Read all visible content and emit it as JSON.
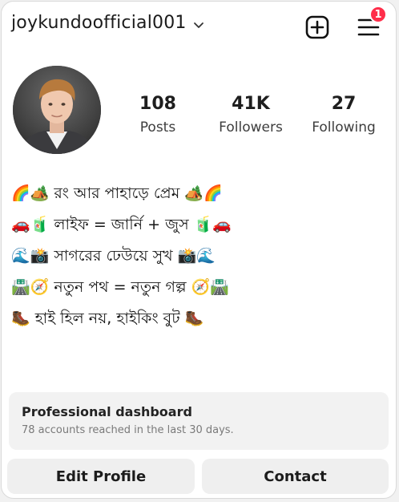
{
  "header": {
    "username": "joykundoofficial001",
    "notification_count": "1"
  },
  "stats": [
    {
      "value": "108",
      "label": "Posts"
    },
    {
      "value": "41K",
      "label": "Followers"
    },
    {
      "value": "27",
      "label": "Following"
    }
  ],
  "bio": {
    "lines": [
      "🌈🏕️ রং আর পাহাড়ে প্রেম 🏕️🌈",
      "🚗🧃 লাইফ = জার্নি + জুস 🧃🚗",
      "🌊📸 সাগরের ঢেউয়ে সুখ 📸🌊",
      "🛣️🧭 নতুন পথ = নতুন গল্প 🧭🛣️",
      "🥾 হাই হিল নয়, হাইকিং বুট 🥾"
    ]
  },
  "dashboard": {
    "title": "Professional dashboard",
    "subtitle": "78 accounts reached in the last 30 days."
  },
  "buttons": {
    "edit_profile": "Edit Profile",
    "contact": "Contact"
  },
  "icons": {
    "chevron": "chevron-down-icon",
    "add": "add-square-icon",
    "menu": "hamburger-menu-icon"
  },
  "colors": {
    "badge": "#ff2d4a",
    "button_bg": "#efefef",
    "dashboard_bg": "#f2f2f2"
  }
}
